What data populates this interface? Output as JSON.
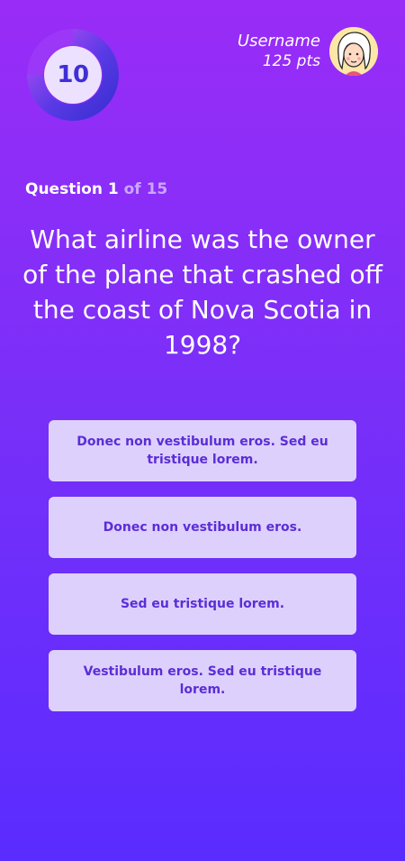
{
  "timer": {
    "value": "10",
    "ring_color": "#4a35d8",
    "track_color": "#a54cf5"
  },
  "user": {
    "name": "Username",
    "points": "125 pts",
    "avatar_icon": "user-avatar"
  },
  "counter": {
    "current": "Question 1",
    "total": "of 15"
  },
  "question": {
    "text": "What airline was the owner of the plane that crashed off the coast of Nova Scotia in 1998?"
  },
  "answers": [
    {
      "label": "Donec non vestibulum eros. Sed eu tristique lorem."
    },
    {
      "label": "Donec non vestibulum eros."
    },
    {
      "label": "Sed eu tristique lorem."
    },
    {
      "label": "Vestibulum eros. Sed eu tristique lorem."
    }
  ]
}
